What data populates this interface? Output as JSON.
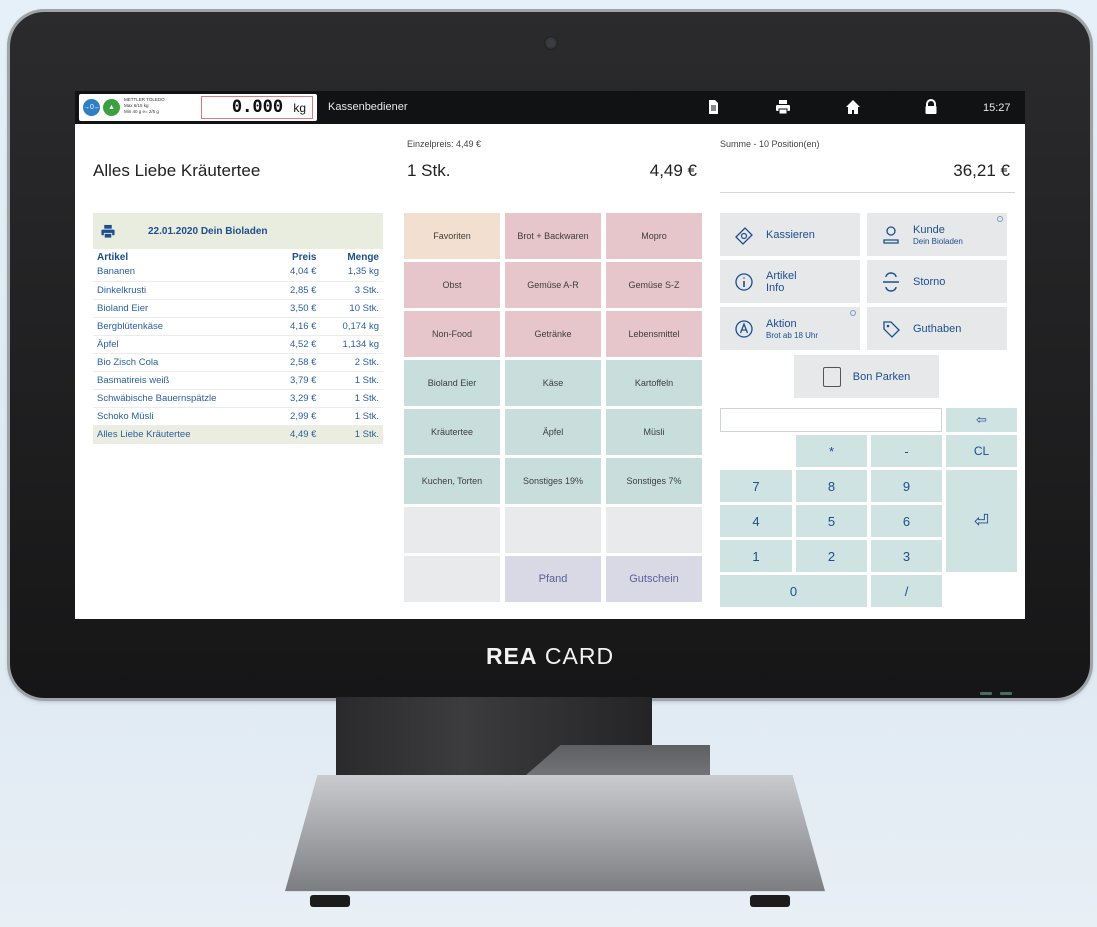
{
  "device": {
    "brand_bold": "REA",
    "brand_rest": " CARD"
  },
  "topbar": {
    "scale_brand": "METTLER TOLEDO",
    "scale_line1": "Max 6/15 kg",
    "scale_line2": "Min 40 g    e= 2/5 g",
    "weight_value": "0.000",
    "weight_unit": "kg",
    "cashier": "Kassenbediener",
    "time": "15:27",
    "icons": [
      "document-icon",
      "printer-icon",
      "home-icon",
      "lock-icon"
    ]
  },
  "current": {
    "item": "Alles Liebe Kräutertee",
    "unit_price": "Einzelpreis: 4,49 €",
    "qty": "1 Stk.",
    "line_price": "4,49 €",
    "sum_label": "Summe - 10 Position(en)",
    "sum_value": "36,21 €"
  },
  "receipt": {
    "header": "22.01.2020 Dein Bioladen",
    "columns": [
      "Artikel",
      "Preis",
      "Menge"
    ],
    "rows": [
      [
        "Bananen",
        "4,04 €",
        "1,35 kg"
      ],
      [
        "Dinkelkrusti",
        "2,85 €",
        "3 Stk."
      ],
      [
        "Bioland Eier",
        "3,50 €",
        "10 Stk."
      ],
      [
        "Bergblütenkäse",
        "4,16 €",
        "0,174 kg"
      ],
      [
        "Äpfel",
        "4,52 €",
        "1,134 kg"
      ],
      [
        "Bio Zisch Cola",
        "2,58 €",
        "2 Stk."
      ],
      [
        "Basmatireis weiß",
        "3,79 €",
        "1 Stk."
      ],
      [
        "Schwäbische Bauernspätzle",
        "3,29 €",
        "1 Stk."
      ],
      [
        "Schoko Müsli",
        "2,99 €",
        "1 Stk."
      ],
      [
        "Alles Liebe Kräutertee",
        "4,49 €",
        "1 Stk."
      ]
    ]
  },
  "categories": [
    "Favoriten",
    "Brot + Backwaren",
    "Mopro",
    "Obst",
    "Gemüse A-R",
    "Gemüse S-Z",
    "Non-Food",
    "Getränke",
    "Lebensmittel",
    "Bioland Eier",
    "Käse",
    "Kartoffeln",
    "Kräutertee",
    "Äpfel",
    "Müsli",
    "Kuchen, Torten",
    "Sonstiges 19%",
    "Sonstiges 7%",
    "",
    "",
    "",
    "",
    "Pfand",
    "Gutschein"
  ],
  "actions": {
    "kassieren": "Kassieren",
    "kunde": "Kunde",
    "kunde_sub": "Dein Bioladen",
    "artikel": "Artikel",
    "artikel_sub": "Info",
    "storno": "Storno",
    "aktion": "Aktion",
    "aktion_sub": "Brot ab 18 Uhr",
    "guthaben": "Guthaben",
    "bon_parken": "Bon Parken"
  },
  "keypad": {
    "backspace": "⇦",
    "keys": [
      "*",
      "-",
      "CL",
      "7",
      "8",
      "9",
      "4",
      "5",
      "6",
      "1",
      "2",
      "3",
      "0",
      "/"
    ],
    "enter": "⏎"
  },
  "colors": {
    "topbar": "#111214",
    "favorite": "#f3dfcf",
    "red_category": "#e6c6cb",
    "teal_category": "#c8dedd",
    "purple_category": "#d9d8e5",
    "keypad": "#cfe3e2",
    "accent_text": "#1d4e8e"
  }
}
